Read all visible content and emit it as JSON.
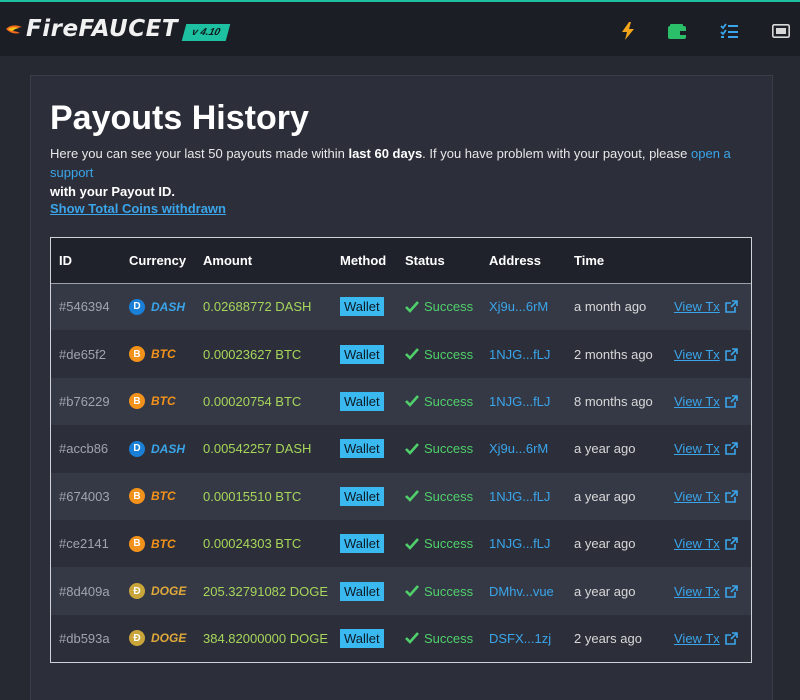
{
  "app": {
    "logo_fire": "Fire",
    "logo_faucet": "FAUCET",
    "version": "v 4.10"
  },
  "nav": {
    "icons": [
      "lightning-icon",
      "wallet-icon",
      "tasks-icon",
      "money-icon"
    ],
    "colors": {
      "lightning": "#f2a51a",
      "wallet": "#2bbf6a",
      "tasks": "#3aa5ea",
      "money": "#d8d8d8"
    }
  },
  "page": {
    "title_strong": "Payouts",
    "title_rest": "History",
    "intro_1": "Here you can see your last 50 payouts made within ",
    "intro_bold_1": "last 60 days",
    "intro_2": ". If you have problem with your payout, please ",
    "intro_link": "open a support",
    "intro_bold_2": "with your Payout ID.",
    "show_total": "Show Total Coins withdrawn"
  },
  "table": {
    "headers": [
      "ID",
      "Currency",
      "Amount",
      "Method",
      "Status",
      "Address",
      "Time",
      ""
    ],
    "rows": [
      {
        "id": "#546394",
        "currency": "DASH",
        "coin": "dash",
        "amount": "0.02688772 DASH",
        "method": "Wallet",
        "status": "Success",
        "address": "Xj9u...6rM",
        "time": "a month ago",
        "view": "View Tx"
      },
      {
        "id": "#de65f2",
        "currency": "BTC",
        "coin": "btc",
        "amount": "0.00023627 BTC",
        "method": "Wallet",
        "status": "Success",
        "address": "1NJG...fLJ",
        "time": "2 months ago",
        "view": "View Tx"
      },
      {
        "id": "#b76229",
        "currency": "BTC",
        "coin": "btc",
        "amount": "0.00020754 BTC",
        "method": "Wallet",
        "status": "Success",
        "address": "1NJG...fLJ",
        "time": "8 months ago",
        "view": "View Tx"
      },
      {
        "id": "#accb86",
        "currency": "DASH",
        "coin": "dash",
        "amount": "0.00542257 DASH",
        "method": "Wallet",
        "status": "Success",
        "address": "Xj9u...6rM",
        "time": "a year ago",
        "view": "View Tx"
      },
      {
        "id": "#674003",
        "currency": "BTC",
        "coin": "btc",
        "amount": "0.00015510 BTC",
        "method": "Wallet",
        "status": "Success",
        "address": "1NJG...fLJ",
        "time": "a year ago",
        "view": "View Tx"
      },
      {
        "id": "#ce2141",
        "currency": "BTC",
        "coin": "btc",
        "amount": "0.00024303 BTC",
        "method": "Wallet",
        "status": "Success",
        "address": "1NJG...fLJ",
        "time": "a year ago",
        "view": "View Tx"
      },
      {
        "id": "#8d409a",
        "currency": "DOGE",
        "coin": "doge",
        "amount": "205.32791082 DOGE",
        "method": "Wallet",
        "status": "Success",
        "address": "DMhv...vue",
        "time": "a year ago",
        "view": "View Tx"
      },
      {
        "id": "#db593a",
        "currency": "DOGE",
        "coin": "doge",
        "amount": "384.82000000 DOGE",
        "method": "Wallet",
        "status": "Success",
        "address": "DSFX...1zj",
        "time": "2 years ago",
        "view": "View Tx"
      }
    ]
  },
  "colors": {
    "accent": "#1ec0a2",
    "link": "#3aa5ea",
    "amount": "#a6d65a",
    "success": "#4fd06a",
    "badge": "#3ab8f0"
  }
}
